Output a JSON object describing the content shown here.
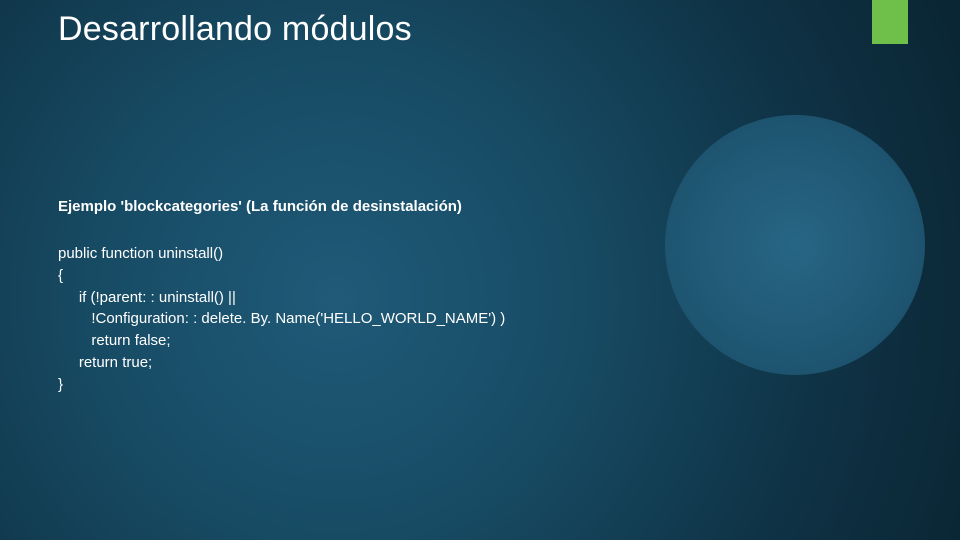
{
  "slide": {
    "title": "Desarrollando módulos",
    "subtitle": "Ejemplo 'blockcategories' (La función de desinstalación)",
    "code": "public function uninstall()\n{\n     if (!parent: : uninstall() ||\n        !Configuration: : delete. By. Name('HELLO_WORLD_NAME') )\n        return false;\n     return true;\n}"
  }
}
